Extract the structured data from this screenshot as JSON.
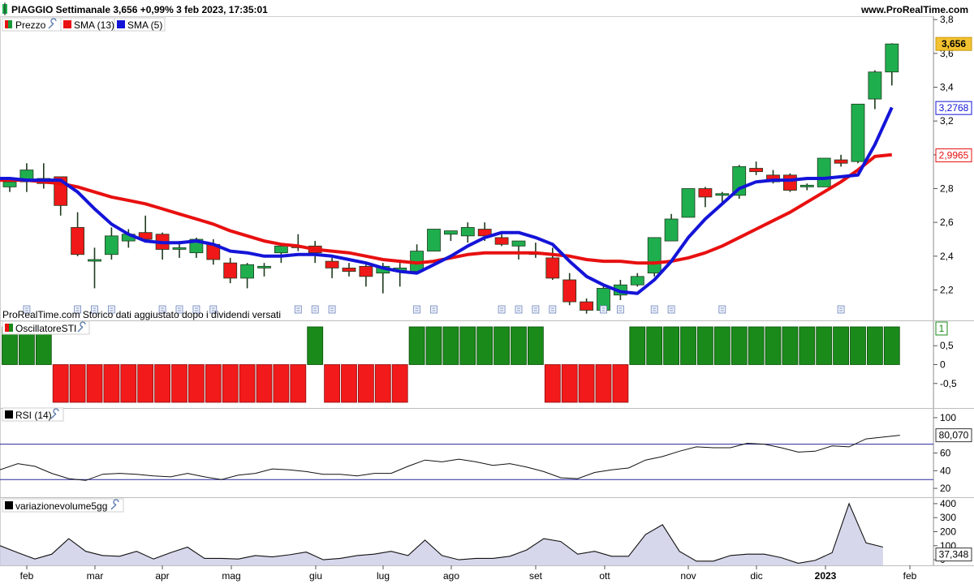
{
  "header": {
    "title": "PIAGGIO Settimanale 3,656 +0,99% 3 feb 2023, 17:35:01",
    "brand": "www.ProRealTime.com"
  },
  "note": "ProRealTime.com Storico dati aggiustato dopo i dividendi versati",
  "legends": {
    "price": "Prezzo",
    "sma13": "SMA (13)",
    "sma5": "SMA (5)",
    "sti": "OscillatoreSTI",
    "rsi": "RSI (14)",
    "vol": "variazionevolume5gg"
  },
  "badges": {
    "last": "3,656",
    "sma5": "3,2768",
    "sma13": "2,9965",
    "sti": "1",
    "rsi": "80,070",
    "vol": "37,348"
  },
  "colors": {
    "up": "#1fae4e",
    "down": "#f01818",
    "sma13": "#e81010",
    "sma5": "#1414d8",
    "sti_up": "#1a8a1a",
    "sti_down": "#f21a1a",
    "badge_last_bg": "#f2c230"
  },
  "x_axis_labels": [
    "feb",
    "mar",
    "apr",
    "mag",
    "giu",
    "lug",
    "ago",
    "set",
    "ott",
    "nov",
    "dic",
    "2023",
    "feb"
  ],
  "chart_data": [
    {
      "type": "candlestick",
      "name": "Prezzo",
      "ylim": [
        2.02,
        3.82
      ],
      "y_ticks": [
        "3,8",
        "3,6",
        "3,4",
        "3,2",
        "3",
        "2,8",
        "2,6",
        "2,4",
        "2,2"
      ],
      "candles": [
        [
          2.81,
          2.86,
          2.78,
          2.84
        ],
        [
          2.84,
          2.95,
          2.78,
          2.91
        ],
        [
          2.86,
          2.95,
          2.8,
          2.83
        ],
        [
          2.87,
          2.87,
          2.64,
          2.7
        ],
        [
          2.57,
          2.66,
          2.4,
          2.41
        ],
        [
          2.38,
          2.45,
          2.21,
          2.38
        ],
        [
          2.41,
          2.57,
          2.38,
          2.52
        ],
        [
          2.49,
          2.56,
          2.45,
          2.53
        ],
        [
          2.54,
          2.64,
          2.48,
          2.5
        ],
        [
          2.53,
          2.54,
          2.38,
          2.44
        ],
        [
          2.45,
          2.49,
          2.39,
          2.45
        ],
        [
          2.42,
          2.51,
          2.39,
          2.5
        ],
        [
          2.47,
          2.5,
          2.35,
          2.38
        ],
        [
          2.36,
          2.39,
          2.24,
          2.27
        ],
        [
          2.27,
          2.36,
          2.21,
          2.35
        ],
        [
          2.33,
          2.36,
          2.28,
          2.34
        ],
        [
          2.42,
          2.46,
          2.36,
          2.46
        ],
        [
          2.45,
          2.53,
          2.43,
          2.46
        ],
        [
          2.46,
          2.49,
          2.36,
          2.42
        ],
        [
          2.37,
          2.39,
          2.27,
          2.33
        ],
        [
          2.33,
          2.36,
          2.28,
          2.31
        ],
        [
          2.34,
          2.35,
          2.22,
          2.28
        ],
        [
          2.3,
          2.36,
          2.18,
          2.34
        ],
        [
          2.31,
          2.36,
          2.22,
          2.33
        ],
        [
          2.31,
          2.47,
          2.31,
          2.43
        ],
        [
          2.43,
          2.56,
          2.43,
          2.56
        ],
        [
          2.53,
          2.55,
          2.49,
          2.55
        ],
        [
          2.52,
          2.6,
          2.48,
          2.57
        ],
        [
          2.56,
          2.6,
          2.49,
          2.52
        ],
        [
          2.51,
          2.53,
          2.46,
          2.47
        ],
        [
          2.46,
          2.49,
          2.38,
          2.49
        ],
        [
          2.42,
          2.48,
          2.39,
          2.41
        ],
        [
          2.39,
          2.45,
          2.26,
          2.27
        ],
        [
          2.26,
          2.3,
          2.11,
          2.13
        ],
        [
          2.13,
          2.15,
          2.06,
          2.08
        ],
        [
          2.08,
          2.23,
          2.07,
          2.21
        ],
        [
          2.17,
          2.26,
          2.14,
          2.23
        ],
        [
          2.23,
          2.3,
          2.22,
          2.28
        ],
        [
          2.3,
          2.51,
          2.28,
          2.51
        ],
        [
          2.49,
          2.65,
          2.49,
          2.62
        ],
        [
          2.63,
          2.8,
          2.63,
          2.8
        ],
        [
          2.8,
          2.81,
          2.69,
          2.75
        ],
        [
          2.76,
          2.78,
          2.7,
          2.77
        ],
        [
          2.76,
          2.94,
          2.74,
          2.93
        ],
        [
          2.92,
          2.96,
          2.88,
          2.9
        ],
        [
          2.88,
          2.91,
          2.83,
          2.84
        ],
        [
          2.88,
          2.89,
          2.78,
          2.79
        ],
        [
          2.81,
          2.83,
          2.79,
          2.82
        ],
        [
          2.81,
          2.98,
          2.81,
          2.98
        ],
        [
          2.97,
          3.0,
          2.93,
          2.95
        ],
        [
          2.96,
          3.3,
          2.95,
          3.3
        ],
        [
          3.33,
          3.5,
          3.27,
          3.49
        ],
        [
          3.49,
          3.66,
          3.41,
          3.656
        ]
      ],
      "sma13": [
        2.85,
        2.85,
        2.84,
        2.83,
        2.81,
        2.78,
        2.75,
        2.73,
        2.71,
        2.68,
        2.65,
        2.62,
        2.59,
        2.55,
        2.52,
        2.49,
        2.47,
        2.46,
        2.44,
        2.43,
        2.42,
        2.4,
        2.38,
        2.37,
        2.36,
        2.37,
        2.39,
        2.41,
        2.42,
        2.42,
        2.42,
        2.42,
        2.41,
        2.4,
        2.38,
        2.37,
        2.37,
        2.36,
        2.36,
        2.37,
        2.39,
        2.42,
        2.46,
        2.51,
        2.56,
        2.61,
        2.66,
        2.72,
        2.78,
        2.84,
        2.91,
        2.99,
        3.0
      ],
      "sma5": [
        2.86,
        2.85,
        2.85,
        2.85,
        2.78,
        2.68,
        2.59,
        2.53,
        2.49,
        2.48,
        2.48,
        2.49,
        2.47,
        2.43,
        2.42,
        2.4,
        2.4,
        2.41,
        2.41,
        2.4,
        2.38,
        2.36,
        2.33,
        2.31,
        2.3,
        2.35,
        2.4,
        2.46,
        2.51,
        2.54,
        2.54,
        2.51,
        2.47,
        2.37,
        2.28,
        2.23,
        2.19,
        2.18,
        2.26,
        2.37,
        2.51,
        2.62,
        2.71,
        2.8,
        2.84,
        2.85,
        2.85,
        2.86,
        2.86,
        2.87,
        2.88,
        3.06,
        3.28
      ]
    },
    {
      "type": "bar",
      "name": "OscillatoreSTI",
      "ylim": [
        -1.15,
        1.15
      ],
      "y_ticks": [
        "0,5",
        "0",
        "-0,5"
      ],
      "values": [
        1,
        1,
        1,
        -1,
        -1,
        -1,
        -1,
        -1,
        -1,
        -1,
        -1,
        -1,
        -1,
        -1,
        -1,
        -1,
        -1,
        -1,
        1,
        -1,
        -1,
        -1,
        -1,
        -1,
        1,
        1,
        1,
        1,
        1,
        1,
        1,
        1,
        -1,
        -1,
        -1,
        -1,
        -1,
        1,
        1,
        1,
        1,
        1,
        1,
        1,
        1,
        1,
        1,
        1,
        1,
        1,
        1,
        1,
        1
      ]
    },
    {
      "type": "line",
      "name": "RSI (14)",
      "ylim": [
        10,
        110
      ],
      "y_ticks": [
        "100",
        "60",
        "40",
        "20"
      ],
      "levels": [
        70,
        30
      ],
      "values": [
        41,
        48,
        45,
        37,
        31,
        29,
        36,
        37,
        36,
        34,
        33,
        37,
        33,
        30,
        35,
        37,
        42,
        41,
        39,
        36,
        36,
        34,
        37,
        37,
        45,
        52,
        50,
        53,
        50,
        46,
        48,
        44,
        39,
        32,
        31,
        38,
        41,
        43,
        52,
        56,
        62,
        67,
        66,
        66,
        71,
        70,
        66,
        61,
        62,
        68,
        67,
        76,
        78,
        80.07
      ]
    },
    {
      "type": "area",
      "name": "variazionevolume5gg",
      "ylim": [
        -40,
        440
      ],
      "y_ticks": [
        "400",
        "300",
        "200",
        "100",
        "0"
      ],
      "values": [
        100,
        50,
        5,
        40,
        150,
        60,
        30,
        25,
        60,
        5,
        50,
        90,
        10,
        10,
        5,
        30,
        20,
        35,
        55,
        0,
        10,
        30,
        40,
        60,
        30,
        140,
        30,
        0,
        10,
        10,
        25,
        70,
        150,
        130,
        40,
        60,
        25,
        25,
        180,
        250,
        60,
        -10,
        -10,
        30,
        40,
        40,
        15,
        -25,
        -5,
        50,
        400,
        120,
        90
      ]
    }
  ]
}
